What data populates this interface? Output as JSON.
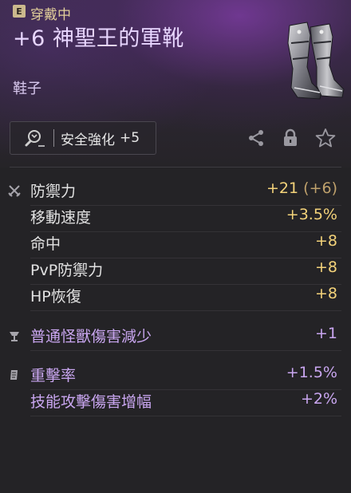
{
  "header": {
    "equip_badge": "E",
    "equip_status": "穿戴中",
    "item_name": "+6 神聖王的軍靴",
    "item_type": "鞋子"
  },
  "enhance": {
    "label": "安全強化",
    "value": "+5"
  },
  "icons": [
    "search-magnifier-icon",
    "share-icon",
    "lock-icon",
    "star-icon",
    "crossed-swords-icon",
    "chalice-icon",
    "scroll-icon"
  ],
  "stats": {
    "base": [
      {
        "name": "防禦力",
        "value": "+21",
        "bonus": "(+6)"
      },
      {
        "name": "移動速度",
        "value": "+3.5%"
      },
      {
        "name": "命中",
        "value": "+8"
      },
      {
        "name": "PvP防禦力",
        "value": "+8"
      },
      {
        "name": "HP恢復",
        "value": "+8"
      }
    ],
    "special": [
      {
        "name": "普通怪獸傷害減少",
        "value": "+1"
      }
    ],
    "option": [
      {
        "name": "重擊率",
        "value": "+1.5%"
      },
      {
        "name": "技能攻擊傷害增幅",
        "value": "+2%"
      }
    ]
  },
  "colors": {
    "title": "#e8d6ff",
    "stat_value": "#f4d37a",
    "option_purple": "#c9a6f0",
    "background": "#242326"
  }
}
